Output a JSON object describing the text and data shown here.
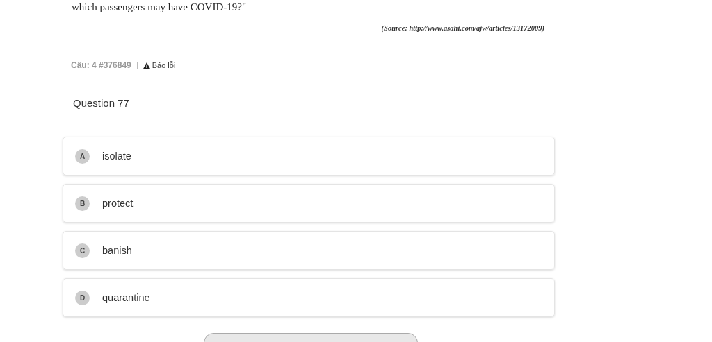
{
  "passage_tail": "which passengers may have COVID-19?\"",
  "source": "(Source: http://www.asahi.com/ajw/articles/13172009)",
  "meta": {
    "question_id": "Câu: 4 #376849",
    "report": "Báo lỗi"
  },
  "question": "Question 77",
  "options": [
    {
      "letter": "A",
      "text": "isolate"
    },
    {
      "letter": "B",
      "text": "protect"
    },
    {
      "letter": "C",
      "text": "banish"
    },
    {
      "letter": "D",
      "text": "quarantine"
    }
  ]
}
